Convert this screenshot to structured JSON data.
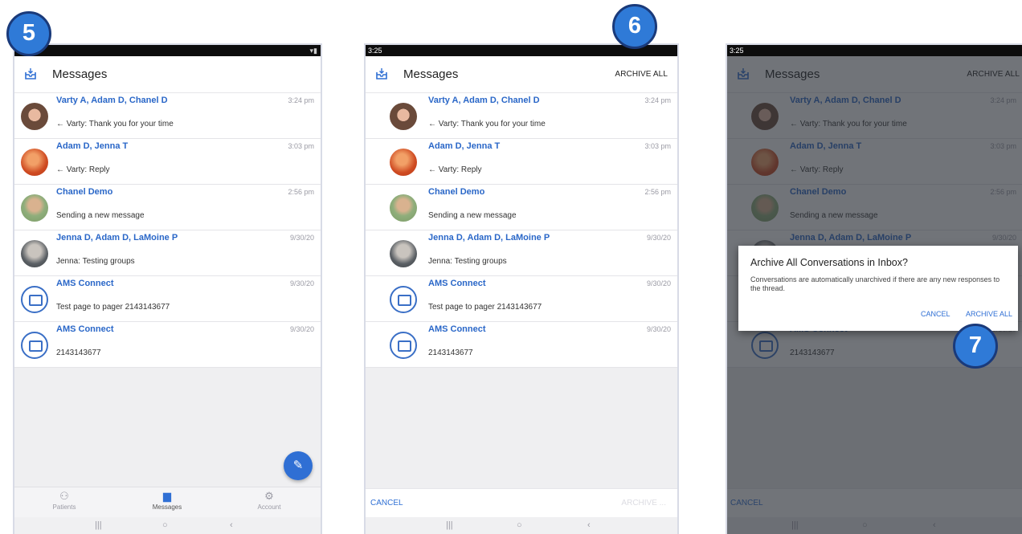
{
  "step_badges": [
    "5",
    "6",
    "7"
  ],
  "status_time": "3:25",
  "app": {
    "title": "Messages",
    "archive_all": "ARCHIVE ALL"
  },
  "conversations": [
    {
      "name": "Varty A, Adam D, Chanel D",
      "time": "3:24 pm",
      "preview": "← Varty: Thank you for your time",
      "avatar": "photo"
    },
    {
      "name": "Adam D, Jenna T",
      "time": "3:03 pm",
      "preview": "← Varty: Reply",
      "avatar": "orange"
    },
    {
      "name": "Chanel Demo",
      "time": "2:56 pm",
      "preview": "Sending a new message",
      "avatar": "green"
    },
    {
      "name": "Jenna D, Adam D, LaMoine P",
      "time": "9/30/20",
      "preview": "Jenna: Testing groups",
      "avatar": "gray"
    },
    {
      "name": "AMS Connect",
      "time": "9/30/20",
      "preview": "Test page to pager 2143143677",
      "avatar": "app"
    },
    {
      "name": "AMS Connect",
      "time": "9/30/20",
      "preview": "2143143677",
      "avatar": "app"
    }
  ],
  "bottom_nav": [
    {
      "label": "Patients",
      "icon": "patients-icon"
    },
    {
      "label": "Messages",
      "icon": "messages-icon"
    },
    {
      "label": "Account",
      "icon": "account-icon"
    }
  ],
  "action_bar": {
    "cancel": "CANCEL",
    "archive": "ARCHIVE ..."
  },
  "dialog": {
    "title": "Archive All Conversations in Inbox?",
    "body": "Conversations are automatically unarchived if there are any new responses to the thread.",
    "cancel": "CANCEL",
    "confirm": "ARCHIVE ALL"
  },
  "screen3_extra": {
    "preview_cut": "2143143677"
  },
  "colors": {
    "accent": "#2f6fd4",
    "link": "#2a67c8",
    "badge": "#2f7ad7"
  }
}
